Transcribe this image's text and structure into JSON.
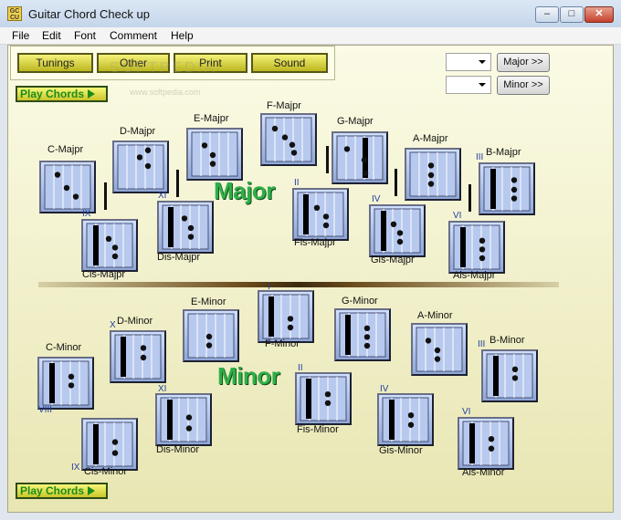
{
  "window": {
    "title": "Guitar Chord Check up",
    "icon_text": "GC CU",
    "controls": {
      "minimize": "–",
      "maximize": "□",
      "close": "✕"
    }
  },
  "menu": [
    "File",
    "Edit",
    "Font",
    "Comment",
    "Help"
  ],
  "toolbar": [
    "Tunings",
    "Other",
    "Print",
    "Sound"
  ],
  "play_label": "Play Chords",
  "right_controls": {
    "major_button": "Major >>",
    "minor_button": "Minor >>"
  },
  "watermark": {
    "main": "SOFTPEDIA",
    "url": "www.softpedia.com"
  },
  "major": {
    "title": "Major",
    "chords": [
      {
        "name": "C-Majpr",
        "roman": "",
        "bars": [],
        "dots": [
          [
            0.28,
            0.22
          ],
          [
            0.48,
            0.52
          ],
          [
            0.68,
            0.72
          ]
        ]
      },
      {
        "name": "Cis-Majpr",
        "roman": "IX",
        "bars": [
          0.2
        ],
        "dots": [
          [
            0.48,
            0.35
          ],
          [
            0.62,
            0.55
          ],
          [
            0.62,
            0.75
          ]
        ]
      },
      {
        "name": "D-Majpr",
        "roman": "",
        "bars": [],
        "dots": [
          [
            0.48,
            0.28
          ],
          [
            0.66,
            0.12
          ],
          [
            0.66,
            0.48
          ]
        ]
      },
      {
        "name": "Dis-Majpr",
        "roman": "XI",
        "bars": [
          0.18
        ],
        "dots": [
          [
            0.48,
            0.3
          ],
          [
            0.62,
            0.52
          ],
          [
            0.62,
            0.72
          ]
        ]
      },
      {
        "name": "E-Majpr",
        "roman": "",
        "bars": [],
        "dots": [
          [
            0.28,
            0.3
          ],
          [
            0.46,
            0.52
          ],
          [
            0.46,
            0.72
          ]
        ]
      },
      {
        "name": "F-Majpr",
        "roman": "",
        "bars": [],
        "dots": [
          [
            0.2,
            0.25
          ],
          [
            0.42,
            0.45
          ],
          [
            0.58,
            0.62
          ],
          [
            0.62,
            0.8
          ]
        ]
      },
      {
        "name": "Fis-Majpr",
        "roman": "II",
        "bars": [
          0.18
        ],
        "dots": [
          [
            0.42,
            0.35
          ],
          [
            0.62,
            0.55
          ],
          [
            0.62,
            0.75
          ]
        ]
      },
      {
        "name": "G-Majpr",
        "roman": "",
        "bars": [
          0.62
        ],
        "dots": [
          [
            0.22,
            0.3
          ],
          [
            0.6,
            0.55
          ],
          [
            0.62,
            0.85
          ]
        ]
      },
      {
        "name": "Gis-Majpr",
        "roman": "IV",
        "bars": [
          0.2
        ],
        "dots": [
          [
            0.42,
            0.35
          ],
          [
            0.56,
            0.55
          ],
          [
            0.56,
            0.75
          ]
        ]
      },
      {
        "name": "A-Majpr",
        "roman": "",
        "bars": [],
        "dots": [
          [
            0.46,
            0.3
          ],
          [
            0.46,
            0.52
          ],
          [
            0.46,
            0.72
          ]
        ]
      },
      {
        "name": "Ais-Majpr",
        "roman": "VI",
        "bars": [
          0.2
        ],
        "dots": [
          [
            0.62,
            0.35
          ],
          [
            0.62,
            0.55
          ],
          [
            0.62,
            0.75
          ]
        ]
      },
      {
        "name": "B-Majpr",
        "roman": "III",
        "bars": [
          0.2
        ],
        "dots": [
          [
            0.66,
            0.3
          ],
          [
            0.66,
            0.52
          ],
          [
            0.66,
            0.72
          ]
        ]
      }
    ]
  },
  "minor": {
    "title": "Minor",
    "chords": [
      {
        "name": "C-Minor",
        "roman": "VIII",
        "bars": [
          0.2
        ],
        "dots": [
          [
            0.62,
            0.35
          ],
          [
            0.62,
            0.55
          ]
        ]
      },
      {
        "name": "Cis-Minor",
        "roman": "IX",
        "bars": [
          0.2
        ],
        "dots": [
          [
            0.62,
            0.45
          ],
          [
            0.62,
            0.7
          ]
        ]
      },
      {
        "name": "D-Minor",
        "roman": "X",
        "bars": [
          0.18
        ],
        "dots": [
          [
            0.62,
            0.3
          ],
          [
            0.62,
            0.52
          ]
        ]
      },
      {
        "name": "Dis-Minor",
        "roman": "XI",
        "bars": [
          0.2
        ],
        "dots": [
          [
            0.62,
            0.45
          ],
          [
            0.62,
            0.7
          ]
        ]
      },
      {
        "name": "E-Minor",
        "roman": "",
        "bars": [],
        "dots": [
          [
            0.46,
            0.52
          ],
          [
            0.46,
            0.72
          ]
        ]
      },
      {
        "name": "F-Minor",
        "roman": "I",
        "bars": [
          0.18
        ],
        "dots": [
          [
            0.6,
            0.55
          ],
          [
            0.6,
            0.75
          ]
        ]
      },
      {
        "name": "Fis-Minor",
        "roman": "II",
        "bars": [
          0.18
        ],
        "dots": [
          [
            0.6,
            0.4
          ],
          [
            0.6,
            0.6
          ]
        ]
      },
      {
        "name": "G-Minor",
        "roman": "",
        "bars": [
          0.18
        ],
        "dots": [
          [
            0.6,
            0.35
          ],
          [
            0.6,
            0.55
          ],
          [
            0.6,
            0.75
          ]
        ]
      },
      {
        "name": "Gis-Minor",
        "roman": "IV",
        "bars": [
          0.2
        ],
        "dots": [
          [
            0.62,
            0.4
          ],
          [
            0.62,
            0.62
          ]
        ]
      },
      {
        "name": "A-Minor",
        "roman": "",
        "bars": [],
        "dots": [
          [
            0.26,
            0.3
          ],
          [
            0.46,
            0.52
          ],
          [
            0.46,
            0.72
          ]
        ]
      },
      {
        "name": "Ais-Minor",
        "roman": "VI",
        "bars": [
          0.2
        ],
        "dots": [
          [
            0.62,
            0.4
          ],
          [
            0.62,
            0.62
          ]
        ]
      },
      {
        "name": "B-Minor",
        "roman": "III",
        "bars": [
          0.2
        ],
        "dots": [
          [
            0.62,
            0.35
          ],
          [
            0.62,
            0.55
          ]
        ]
      }
    ]
  },
  "colors": {
    "chord_dot": "#111111",
    "chord_bg": "#b7c9ee",
    "big_word": "#2fae47"
  }
}
